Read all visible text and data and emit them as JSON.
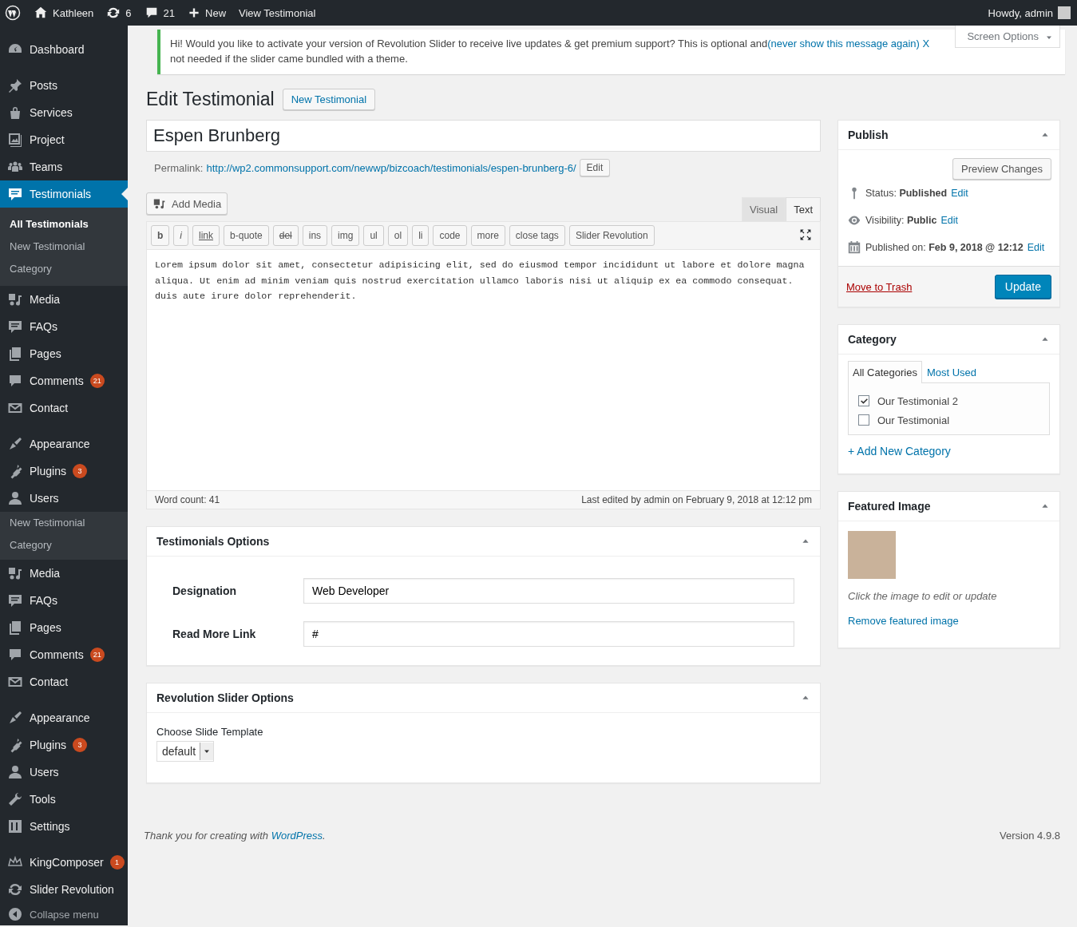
{
  "admin_bar": {
    "site": "Kathleen",
    "updates": "6",
    "comments": "21",
    "new": "New",
    "view": "View Testimonial",
    "greeting": "Howdy, admin"
  },
  "sidebar": {
    "items": [
      {
        "kind": "menu",
        "label": "Dashboard",
        "selected": false
      },
      {
        "kind": "separator"
      },
      {
        "kind": "menu",
        "label": "Posts",
        "selected": false
      },
      {
        "kind": "menu",
        "label": "Services",
        "selected": false
      },
      {
        "kind": "menu",
        "label": "Project",
        "selected": false
      },
      {
        "kind": "menu",
        "label": "Teams",
        "selected": false
      },
      {
        "kind": "menu",
        "label": "Testimonials",
        "selected": true,
        "children": [
          {
            "label": "All Testimonials",
            "selected": true
          },
          {
            "label": "New Testimonial",
            "selected": false
          },
          {
            "label": "Category",
            "selected": false
          }
        ]
      },
      {
        "kind": "menu",
        "label": "Media",
        "selected": false
      },
      {
        "kind": "menu",
        "label": "FAQs",
        "selected": false
      },
      {
        "kind": "menu",
        "label": "Pages",
        "selected": false
      },
      {
        "kind": "menu",
        "label": "Comments",
        "badge": "21",
        "selected": false
      },
      {
        "kind": "menu",
        "label": "Contact",
        "selected": false
      },
      {
        "kind": "separator"
      },
      {
        "kind": "menu",
        "label": "Appearance",
        "selected": false
      },
      {
        "kind": "menu",
        "label": "Plugins",
        "badge": "3",
        "selected": false
      },
      {
        "kind": "menu",
        "label": "Users",
        "selected": false,
        "children": [
          {
            "label": "New Testimonial",
            "selected": false
          },
          {
            "label": "Category",
            "selected": false
          }
        ]
      },
      {
        "kind": "menu",
        "label": "Media",
        "selected": false
      },
      {
        "kind": "menu",
        "label": "FAQs",
        "selected": false
      },
      {
        "kind": "menu",
        "label": "Pages",
        "selected": false
      },
      {
        "kind": "menu",
        "label": "Comments",
        "badge": "21",
        "selected": false
      },
      {
        "kind": "menu",
        "label": "Contact",
        "selected": false
      },
      {
        "kind": "separator"
      },
      {
        "kind": "menu",
        "label": "Appearance",
        "selected": false
      },
      {
        "kind": "menu",
        "label": "Plugins",
        "badge": "3",
        "selected": false
      },
      {
        "kind": "menu",
        "label": "Users",
        "selected": false
      },
      {
        "kind": "menu",
        "label": "Tools",
        "selected": false
      },
      {
        "kind": "menu",
        "label": "Settings",
        "selected": false
      },
      {
        "kind": "separator"
      },
      {
        "kind": "menu",
        "label": "KingComposer",
        "badge": "1",
        "selected": false
      },
      {
        "kind": "menu",
        "label": "Slider Revolution",
        "selected": false
      },
      {
        "kind": "collapse",
        "label": "Collapse menu"
      }
    ]
  },
  "notice": {
    "text_before": "Hi! Would you like to activate your version of Revolution Slider to receive live updates & get premium support? This is optional and",
    "link": "(never show this message again)",
    "close": "X",
    "text_after": "not needed if the slider came bundled with a theme."
  },
  "screen_options": "Screen Options",
  "heading": {
    "title": "Edit Testimonial",
    "button": "New Testimonial"
  },
  "post_title": "Espen Brunberg",
  "permalink": {
    "label": "Permalink:",
    "url": "http://wp2.commonsupport.com/newwp/bizcoach/testimonials/espen-brunberg-6/",
    "button": "Edit"
  },
  "editor": {
    "add_media": "Add Media",
    "tabs": [
      {
        "label": "Visual",
        "selected": false
      },
      {
        "label": "Text",
        "selected": true
      }
    ],
    "quicktags": [
      {
        "kind": "bold",
        "label": "b"
      },
      {
        "kind": "italic",
        "label": "i"
      },
      {
        "kind": "link",
        "label": "link"
      },
      {
        "kind": "plain",
        "label": "b-quote"
      },
      {
        "kind": "strike",
        "label": "del"
      },
      {
        "kind": "plain",
        "label": "ins"
      },
      {
        "kind": "plain",
        "label": "img"
      },
      {
        "kind": "plain",
        "label": "ul"
      },
      {
        "kind": "plain",
        "label": "ol"
      },
      {
        "kind": "plain",
        "label": "li"
      },
      {
        "kind": "plain",
        "label": "code"
      },
      {
        "kind": "plain",
        "label": "more"
      },
      {
        "kind": "plain",
        "label": "close tags"
      },
      {
        "kind": "plain",
        "label": "Slider Revolution"
      }
    ],
    "content": "Lorem ipsum dolor sit amet, consectetur adipisicing elit, sed do eiusmod tempor incididunt ut labore et dolore magna aliqua. Ut enim ad minim veniam quis nostrud exercitation ullamco laboris nisi ut aliquip ex ea commodo consequat.\nduis aute irure dolor reprehenderit.",
    "word_count": "Word count: 41",
    "last_edited": "Last edited by admin on February 9, 2018 at 12:12 pm"
  },
  "testimonial_options": {
    "title": "Testimonials Options",
    "fields": [
      {
        "label": "Designation",
        "value": "Web Developer"
      },
      {
        "label": "Read More Link",
        "value": "#"
      }
    ]
  },
  "slider_options": {
    "title": "Revolution Slider Options",
    "label": "Choose Slide Template",
    "select": "default"
  },
  "publish": {
    "title": "Publish",
    "preview": "Preview Changes",
    "rows": [
      {
        "kind": "status",
        "text": "Status: **Published**",
        "link": "Edit"
      },
      {
        "kind": "visibility",
        "text": "Visibility: **Public**",
        "link": "Edit"
      },
      {
        "kind": "date",
        "text": "Published on: **Feb 9, 2018 @ 12:12**",
        "link": "Edit"
      }
    ],
    "trash": "Move to Trash",
    "update": "Update"
  },
  "category": {
    "title": "Category",
    "tabs": [
      {
        "label": "All Categories",
        "selected": true
      },
      {
        "label": "Most Used",
        "selected": false
      }
    ],
    "items": [
      {
        "label": "Our Testimonial 2",
        "checked": true
      },
      {
        "label": "Our Testimonial",
        "checked": false
      }
    ],
    "add": "+ Add New Category"
  },
  "featured_image": {
    "title": "Featured Image",
    "hint": "Click the image to edit or update",
    "remove": "Remove featured image"
  },
  "footer": {
    "text_before": "Thank you for creating with ",
    "link": "WordPress",
    "text_after": ".",
    "version": "Version 4.9.8"
  }
}
